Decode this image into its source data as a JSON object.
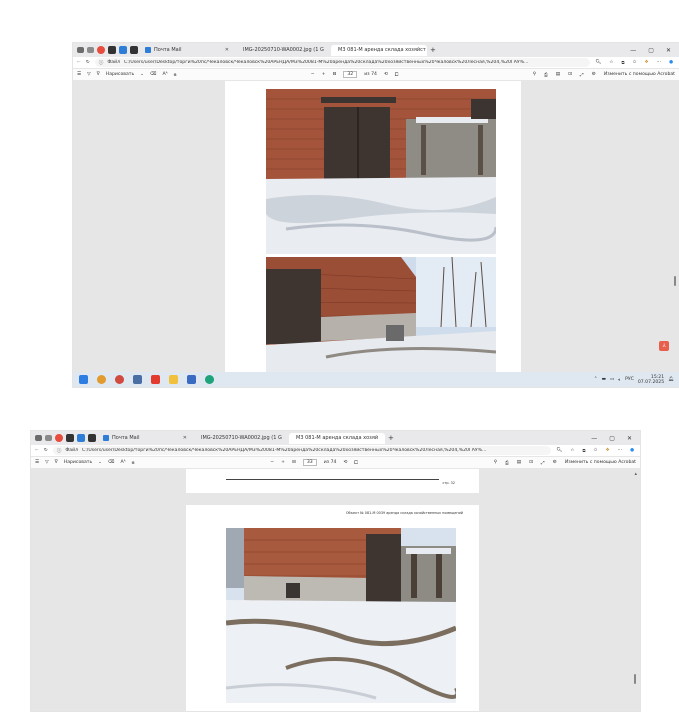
{
  "shot1": {
    "tabs": [
      {
        "label": "Почта Mail",
        "icon": "mail-favicon"
      },
      {
        "label": "IMG-20250710-WA0002.jpg (1 G",
        "icon": "image-favicon"
      },
      {
        "label": "М3 081-М аренда склада хозяйст",
        "icon": "pdf-favicon"
      }
    ],
    "new_tab": "+",
    "window_controls": [
      "—",
      "▢",
      "✕"
    ],
    "address": {
      "scheme": "Файл",
      "url": "C:/Users/user/Desktop/торги%20пс/Чекаловск/Чекаловск%20АРЕНДА/М3%20081-М%20аренда%20склада%20хозяйственных%20Чкаловск%20Лесная,%204,%20ГАУ%..."
    },
    "pdf_toolbar": {
      "draw_label": "Нарисовать",
      "font_size_label": "Aᴬ",
      "zoom_out": "−",
      "zoom_in": "+",
      "page_current": "32",
      "page_total": "из 74",
      "acrobat_label": "Изменить с помощью Acrobat"
    },
    "tray": {
      "lang": "РУС",
      "time": "15:21",
      "date": "07.07.2025"
    }
  },
  "shot2": {
    "tabs": [
      {
        "label": "Почта Mail",
        "icon": "mail-favicon"
      },
      {
        "label": "IMG-20250710-WA0002.jpg (1 G",
        "icon": "image-favicon"
      },
      {
        "label": "М3 081-М аренда склада хозяй",
        "icon": "pdf-favicon"
      }
    ],
    "new_tab": "+",
    "window_controls": [
      "—",
      "▢",
      "✕"
    ],
    "address": {
      "scheme": "Файл",
      "url": "C:/Users/user/Desktop/торги%20пс/Чекаловск/Чекаловск%20АРЕНДА/М3%20081-М%20аренда%20склада%20хозяйственных%20Чкаловск%20Лесная,%204,%20ГАУ%..."
    },
    "pdf_toolbar": {
      "draw_label": "Нарисовать",
      "font_size_label": "Aᴬ",
      "zoom_out": "−",
      "zoom_in": "+",
      "page_current": "33",
      "page_total": "из 74",
      "acrobat_label": "Изменить с помощью Acrobat"
    },
    "page_footer_number": "стр. 32",
    "page_caption": "Объект № 081-М 0039 аренда склада хозяйственных помещений"
  },
  "colors": {
    "brick": "#8a3f2c",
    "snow": "#eef0f4",
    "sky": "#dfe9f5",
    "taskbar": "#dfe7f0",
    "acrobat_red": "#e8604c"
  }
}
